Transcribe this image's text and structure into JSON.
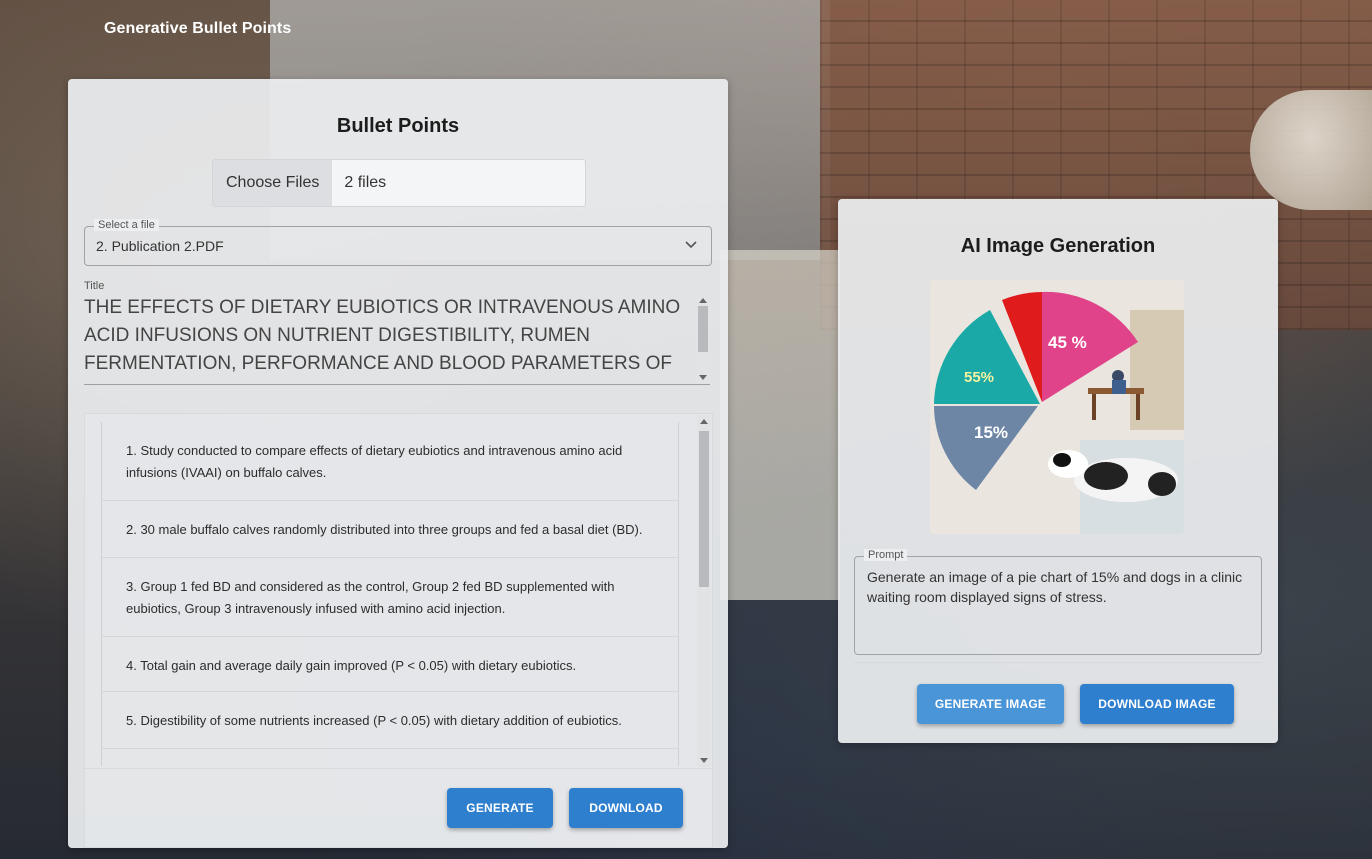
{
  "app": {
    "title": "Generative Bullet Points"
  },
  "bullet_panel": {
    "heading": "Bullet Points",
    "choose_files_label": "Choose Files",
    "file_count": "2 files",
    "select_label": "Select a file",
    "selected_file": "2. Publication 2.PDF",
    "title_label": "Title",
    "title_text": "THE EFFECTS OF DIETARY EUBIOTICS OR INTRAVENOUS AMINO ACID INFUSIONS ON NUTRIENT DIGESTIBILITY, RUMEN FERMENTATION, PERFORMANCE AND BLOOD PARAMETERS OF",
    "bullets": [
      "1. Study conducted to compare effects of dietary eubiotics and intravenous amino acid infusions (IVAAI) on buffalo calves.",
      "2. 30 male buffalo calves randomly distributed into three groups and fed a basal diet (BD).",
      "3. Group 1 fed BD and considered as the control, Group 2 fed BD supplemented with eubiotics, Group 3 intravenously infused with amino acid injection.",
      "4. Total gain and average daily gain improved (P < 0.05) with dietary eubiotics.",
      "5. Digestibility of some nutrients increased (P < 0.05) with dietary addition of eubiotics."
    ],
    "generate_label": "GENERATE",
    "download_label": "DOWNLOAD"
  },
  "image_panel": {
    "heading": "AI Image Generation",
    "image_labels": {
      "pink": "45 %",
      "teal": "55%",
      "slate": "15%"
    },
    "prompt_label": "Prompt",
    "prompt_text": "Generate an image of a pie chart of 15% and dogs in a clinic waiting room displayed signs of stress.",
    "generate_label": "GENERATE IMAGE",
    "download_label": "DOWNLOAD IMAGE"
  },
  "colors": {
    "button": "#2f7fcf",
    "button_light": "#4a94d8",
    "pie_pink": "#e0438a",
    "pie_teal": "#1aa9a6",
    "pie_red": "#e01b1b",
    "pie_slate": "#6e86a6"
  }
}
